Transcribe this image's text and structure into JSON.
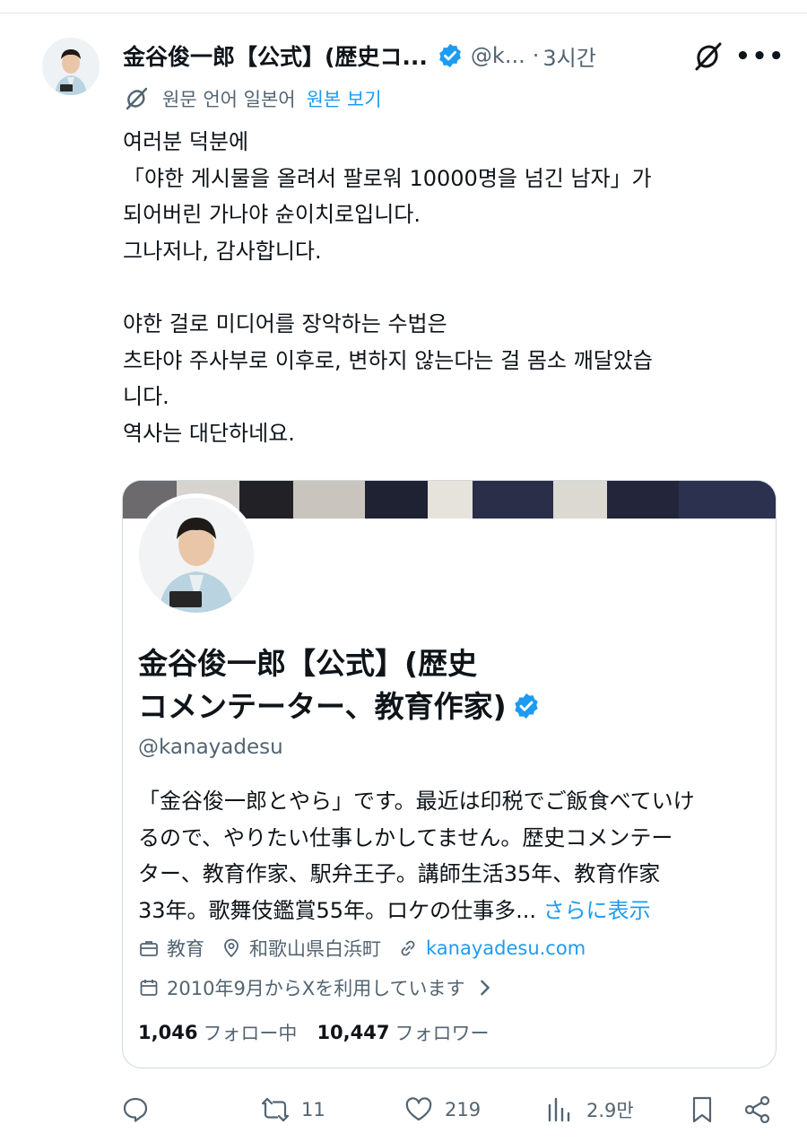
{
  "tweet": {
    "author_name": "金谷俊一郎【公式】(歴史コ...",
    "handle": "@k...",
    "separator": "·",
    "time": "3시간",
    "translation_note": "원문 언어 일본어",
    "view_original": "원본 보기",
    "body_lines": [
      "여러분 덕분에",
      "「야한 게시물을 올려서 팔로워 10000명을 넘긴 남자」가",
      "되어버린 가나야 슌이치로입니다.",
      "그나저나, 감사합니다.",
      "",
      "야한 걸로 미디어를 장악하는 수법은",
      "츠타야 주사부로 이후로, 변하지 않는다는 걸 몸소 깨달았습",
      "니다.",
      "역사는 대단하네요."
    ]
  },
  "card": {
    "name_line1": "金谷俊一郎【公式】(歴史",
    "name_line2": "コメンテーター、教育作家)",
    "handle": "@kanayadesu",
    "bio_lines": [
      "「金谷俊一郎とやら」です。最近は印税でご飯食べていけ",
      "るので、やりたい仕事しかしてません。歴史コメンテー",
      "ター、教育作家、駅弁王子。講師生活35年、教育作家",
      "33年。歌舞伎鑑賞55年。ロケの仕事多..."
    ],
    "show_more": "さらに表示",
    "category": "教育",
    "location": "和歌山県白浜町",
    "website": "kanayadesu.com",
    "joined": "2010年9月からXを利用しています",
    "following_count": "1,046",
    "following_label": "フォロー中",
    "followers_count": "10,447",
    "followers_label": "フォロワー"
  },
  "actions": {
    "reply_count": "",
    "retweet_count": "11",
    "like_count": "219",
    "views_count": "2.9만"
  },
  "colors": {
    "link": "#1d9bf0",
    "muted": "#536471",
    "text": "#0f1419",
    "border": "#cfd9de"
  }
}
